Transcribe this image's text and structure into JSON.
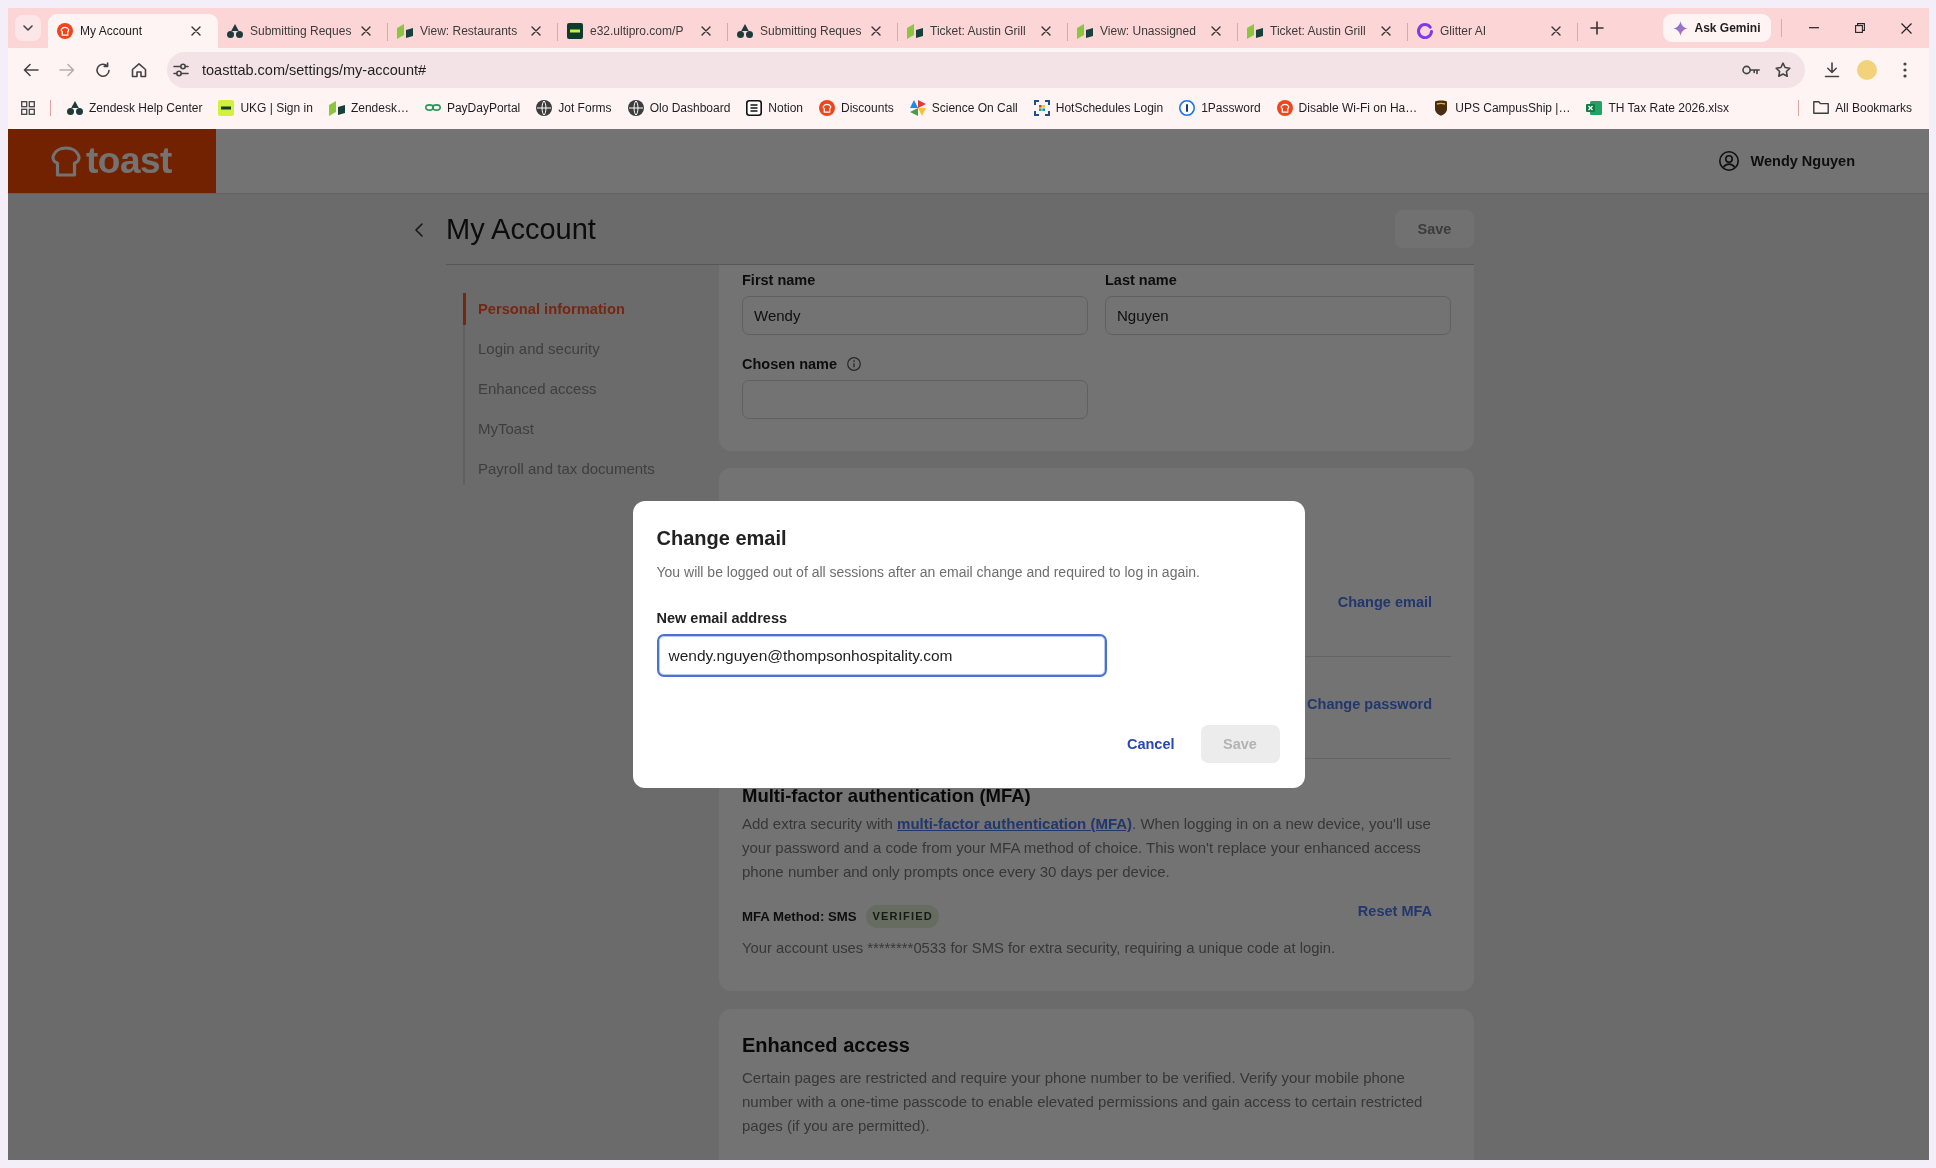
{
  "browser": {
    "tabs": [
      {
        "title": "My Account",
        "kind": "bread",
        "selected": true
      },
      {
        "title": "Submitting Reques",
        "kind": "trio",
        "selected": false
      },
      {
        "title": "View: Restaurants",
        "kind": "flag",
        "selected": false
      },
      {
        "title": "e32.ultipro.com/P",
        "kind": "tile",
        "selected": false
      },
      {
        "title": "Submitting Reques",
        "kind": "trio",
        "selected": false
      },
      {
        "title": "Ticket: Austin Grill",
        "kind": "flag",
        "selected": false
      },
      {
        "title": "View: Unassigned",
        "kind": "flag",
        "selected": false
      },
      {
        "title": "Ticket: Austin Grill",
        "kind": "flag",
        "selected": false
      },
      {
        "title": "Glitter AI",
        "kind": "hook",
        "selected": false
      }
    ],
    "gemini_button": "Ask Gemini",
    "toolbar": {
      "url": "toasttab.com/settings/my-account#",
      "forward_disabled": true
    },
    "bookmarks": [
      {
        "title": "Zendesk Help Center",
        "kind": "trio"
      },
      {
        "title": "UKG | Sign in",
        "kind": "chip"
      },
      {
        "title": "Zendesk…",
        "kind": "flag"
      },
      {
        "title": "PayDayPortal",
        "kind": "chain"
      },
      {
        "title": "Jot Forms",
        "kind": "globe"
      },
      {
        "title": "Olo Dashboard",
        "kind": "globe"
      },
      {
        "title": "Notion",
        "kind": "cube"
      },
      {
        "title": "Discounts",
        "kind": "bread"
      },
      {
        "title": "Science On Call",
        "kind": "pinwheel"
      },
      {
        "title": "HotSchedules Login",
        "kind": "frame"
      },
      {
        "title": "1Password",
        "kind": "ring"
      },
      {
        "title": "Disable Wi-Fi on Ha…",
        "kind": "bread"
      },
      {
        "title": "UPS CampusShip |…",
        "kind": "shield"
      },
      {
        "title": "TH Tax Rate 2026.xlsx",
        "kind": "sheet"
      }
    ],
    "all_bookmarks": "All Bookmarks"
  },
  "header": {
    "logo": "toast",
    "user": "Wendy Nguyen"
  },
  "page": {
    "title": "My Account",
    "save_button": {
      "label": "Save",
      "disabled": true
    }
  },
  "sidebar": {
    "items": [
      {
        "label": "Personal information",
        "selected": true
      },
      {
        "label": "Login and security",
        "selected": false
      },
      {
        "label": "Enhanced access",
        "selected": false
      },
      {
        "label": "MyToast",
        "selected": false
      },
      {
        "label": "Payroll and tax documents",
        "selected": false
      }
    ]
  },
  "personal_information": {
    "fields": [
      {
        "label": "First name",
        "value": "Wendy",
        "info": false
      },
      {
        "label": "Last name",
        "value": "Nguyen",
        "info": false
      },
      {
        "label": "Chosen name",
        "info": true
      }
    ]
  },
  "login_and_security": {
    "actions": [
      "Change email",
      "Change password"
    ],
    "mfa": {
      "title": "Multi-factor authentication (MFA)",
      "description": [
        {
          "text": "Add extra security with ",
          "kind": "text"
        },
        {
          "text": "multi-factor authentication (MFA)",
          "kind": "link"
        },
        {
          "text": ". When logging in on a new device, you'll use your password and a code from your MFA method of choice. This won't replace your enhanced access phone number and only prompts once every 30 days per device.",
          "kind": "text"
        }
      ],
      "method": "MFA Method: SMS",
      "badge": "VERIFIED",
      "action": "Reset MFA",
      "note": "Your account uses ********0533 for SMS for extra security, requiring a unique code at login."
    }
  },
  "enhanced_access": {
    "title": "Enhanced access",
    "description": "Certain pages are restricted and require your phone number to be verified. Verify your mobile phone number with a one-time passcode to enable elevated permissions and gain access to certain restricted pages (if you are permitted)."
  },
  "modal": {
    "title": "Change email",
    "description": "You will be logged out of all sessions after an email change and required to log in again.",
    "field": {
      "label": "New email address",
      "value": "wendy.nguyen@thompsonhospitality.com",
      "focused": true
    },
    "buttons": [
      {
        "label": "Cancel",
        "kind": "link",
        "disabled": false
      },
      {
        "label": "Save",
        "kind": "primary",
        "disabled": true
      }
    ]
  }
}
